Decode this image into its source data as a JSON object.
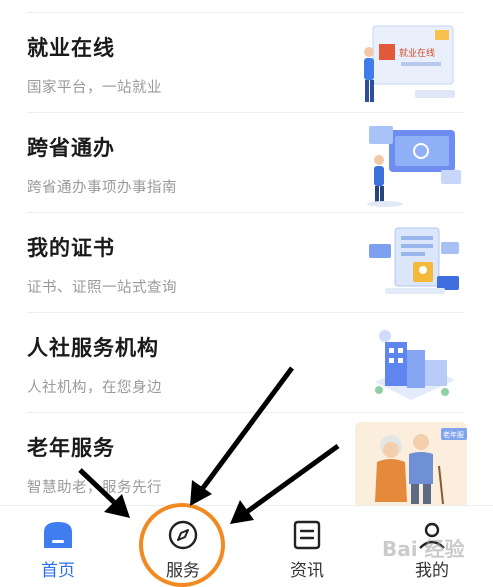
{
  "services": [
    {
      "title": "就业在线",
      "subtitle": "国家平台，一站就业",
      "illus_text": "就业在线"
    },
    {
      "title": "跨省通办",
      "subtitle": "跨省通办事项办事指南"
    },
    {
      "title": "我的证书",
      "subtitle": "证书、证照一站式查询"
    },
    {
      "title": "人社服务机构",
      "subtitle": "人社机构，在您身边"
    },
    {
      "title": "老年服务",
      "subtitle": "智慧助老，服务先行",
      "illus_text": "老年服"
    }
  ],
  "tabbar": [
    {
      "label": "首页",
      "icon": "home-icon",
      "active": true
    },
    {
      "label": "服务",
      "icon": "compass-icon",
      "active": false
    },
    {
      "label": "资讯",
      "icon": "news-icon",
      "active": false
    },
    {
      "label": "我的",
      "icon": "profile-icon",
      "active": false
    }
  ],
  "watermark": "Bai 经验",
  "colors": {
    "accent": "#2c6de9",
    "highlight": "#f28a24"
  }
}
